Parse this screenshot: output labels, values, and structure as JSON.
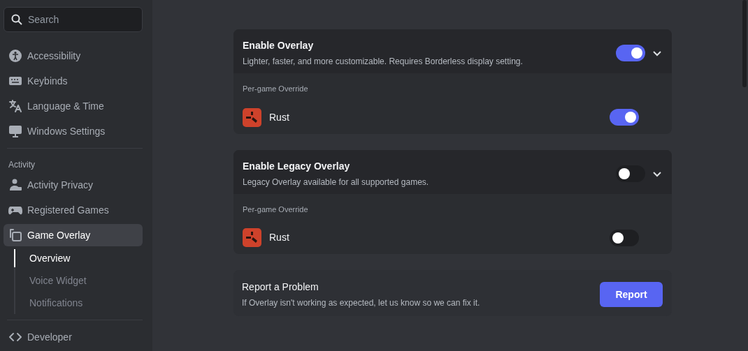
{
  "search": {
    "placeholder": "Search"
  },
  "sidebar": {
    "sections": [
      {
        "items": [
          {
            "label": "Accessibility",
            "selected": false
          },
          {
            "label": "Keybinds",
            "selected": false
          },
          {
            "label": "Language & Time",
            "selected": false
          },
          {
            "label": "Windows Settings",
            "selected": false
          }
        ]
      },
      {
        "header": "Activity",
        "items": [
          {
            "label": "Activity Privacy",
            "selected": false
          },
          {
            "label": "Registered Games",
            "selected": false
          },
          {
            "label": "Game Overlay",
            "selected": true,
            "children": [
              {
                "label": "Overview",
                "selected": true
              },
              {
                "label": "Voice Widget",
                "selected": false
              },
              {
                "label": "Notifications",
                "selected": false
              }
            ]
          }
        ]
      },
      {
        "items": [
          {
            "label": "Developer",
            "selected": false
          }
        ]
      }
    ]
  },
  "cards": [
    {
      "title": "Enable Overlay",
      "description": "Lighter, faster, and more customizable. Requires Borderless display setting.",
      "on": true,
      "override_label": "Per-game Override",
      "games": [
        {
          "name": "Rust",
          "on": true
        }
      ]
    },
    {
      "title": "Enable Legacy Overlay",
      "description": "Legacy Overlay available for all supported games.",
      "on": false,
      "override_label": "Per-game Override",
      "games": [
        {
          "name": "Rust",
          "on": false
        }
      ]
    }
  ],
  "report": {
    "title": "Report a Problem",
    "description": "If Overlay isn't working as expected, let us know so we can fix it.",
    "button": "Report"
  }
}
